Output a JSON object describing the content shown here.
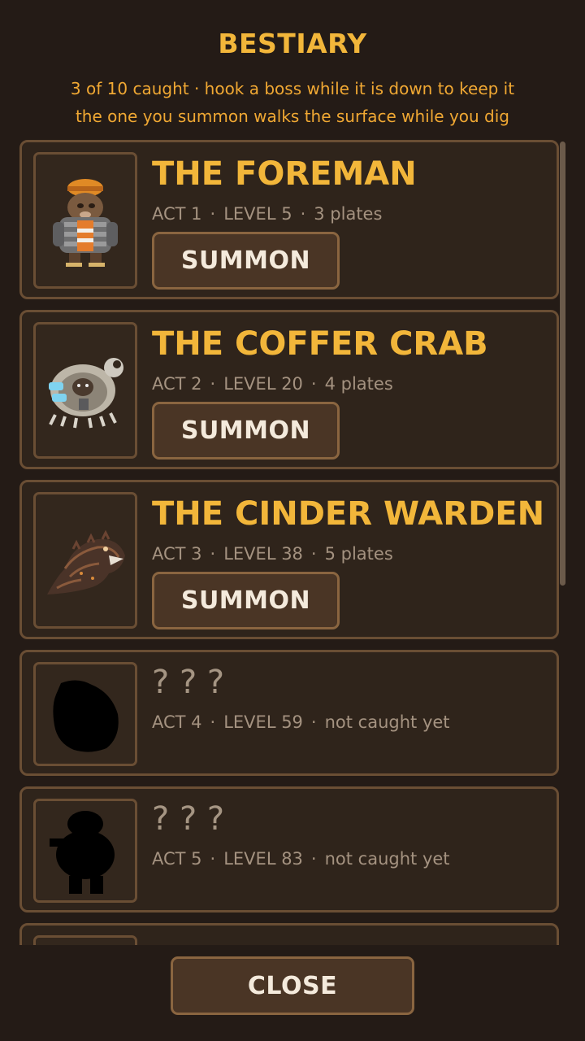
{
  "header": {
    "title": "BESTIARY",
    "subtitle_line1": "3 of 10 caught  ·  hook a boss while it is down to keep it",
    "subtitle_line2": "the one you summon walks the surface while you dig"
  },
  "bosses": [
    {
      "name": "THE FOREMAN",
      "act": "ACT 1",
      "level": "LEVEL 5",
      "info": "3 plates",
      "summon_label": "SUMMON",
      "caught": true
    },
    {
      "name": "THE COFFER CRAB",
      "act": "ACT 2",
      "level": "LEVEL 20",
      "info": "4 plates",
      "summon_label": "SUMMON",
      "caught": true
    },
    {
      "name": "THE CINDER WARDEN",
      "act": "ACT 3",
      "level": "LEVEL 38",
      "info": "5 plates",
      "summon_label": "SUMMON",
      "caught": true
    },
    {
      "name": "? ? ?",
      "act": "ACT 4",
      "level": "LEVEL 59",
      "info": "not caught yet",
      "caught": false
    },
    {
      "name": "? ? ?",
      "act": "ACT 5",
      "level": "LEVEL 83",
      "info": "not caught yet",
      "caught": false
    }
  ],
  "separator": "·",
  "footer": {
    "close_label": "CLOSE"
  }
}
